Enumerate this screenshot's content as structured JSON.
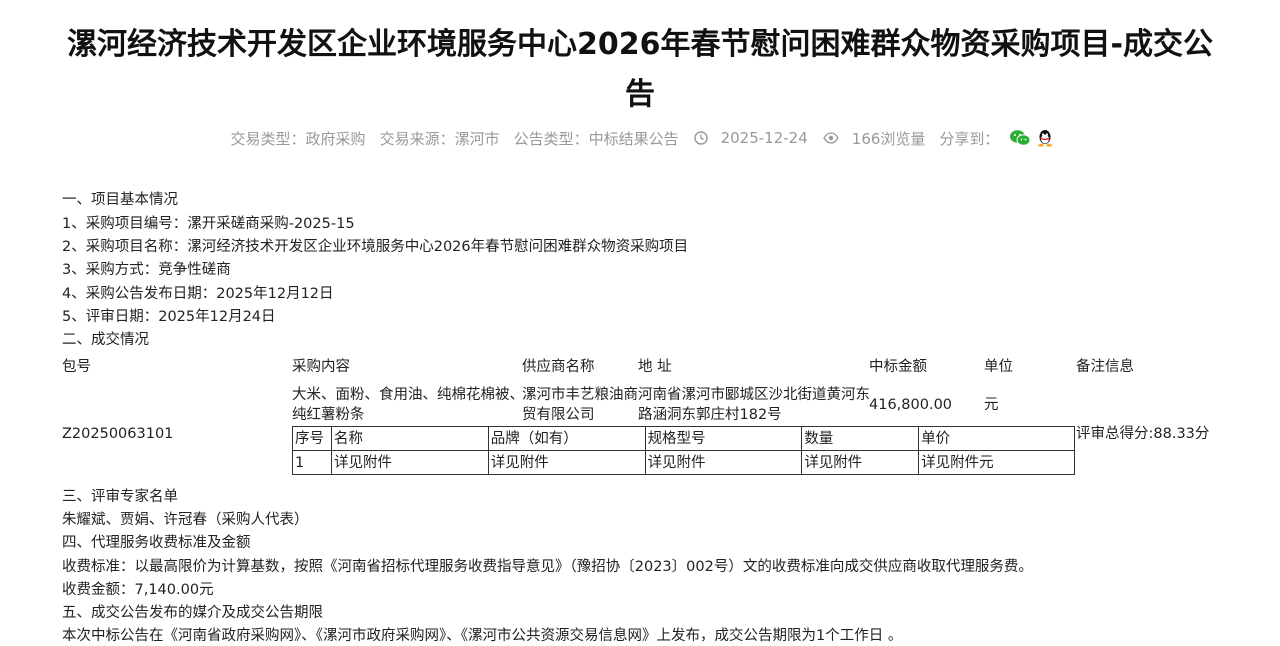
{
  "title": "漯河经济技术开发区企业环境服务中心2026年春节慰问困难群众物资采购项目-成交公告",
  "meta": {
    "trade_type": "交易类型：政府采购",
    "trade_source": "交易来源：漯河市",
    "notice_type": "公告类型：中标结果公告",
    "date": "2025-12-24",
    "views": "166浏览量",
    "share_label": "分享到："
  },
  "section1": {
    "heading": "一、项目基本情况",
    "items": [
      "1、采购项目编号：漯开采磋商采购-2025-15",
      "2、采购项目名称：漯河经济技术开发区企业环境服务中心2026年春节慰问困难群众物资采购项目",
      "3、采购方式：竞争性磋商",
      "4、采购公告发布日期：2025年12月12日",
      "5、评审日期：2025年12月24日"
    ]
  },
  "section2": {
    "heading": "二、成交情况",
    "headers": [
      "包号",
      "采购内容",
      "供应商名称",
      "地 址",
      "中标金额",
      "单位",
      "备注信息"
    ],
    "row": {
      "package": "Z20250063101",
      "content_line1": "大米、面粉、食用油、纯棉花棉被、",
      "content_line2": "纯红薯粉条",
      "supplier_line1": "漯河市丰艺粮油商",
      "supplier_line2": "贸有限公司",
      "address_line1": "河南省漯河市郾城区沙北街道黄河东",
      "address_line2": "路涵洞东郭庄村182号",
      "amount": "416,800.00",
      "unit": "元",
      "remark": "评审总得分:88.33分"
    },
    "sub_table": {
      "headers": [
        "序号",
        "名称",
        "品牌（如有）",
        "规格型号",
        "数量",
        "单价"
      ],
      "rows": [
        [
          "1",
          "详见附件",
          "详见附件",
          "详见附件",
          "详见附件",
          "详见附件元"
        ]
      ]
    }
  },
  "section3": {
    "heading": "三、评审专家名单",
    "text": "朱耀斌、贾娟、许冠春（采购人代表）"
  },
  "section4": {
    "heading": "四、代理服务收费标准及金额",
    "standard": "收费标准：以最高限价为计算基数，按照《河南省招标代理服务收费指导意见》（豫招协〔2023〕002号）文的收费标准向成交供应商收取代理服务费。",
    "amount": "收费金额：7,140.00元"
  },
  "section5": {
    "heading": "五、成交公告发布的媒介及成交公告期限",
    "text": "本次中标公告在《河南省政府采购网》、《漯河市政府采购网》、《漯河市公共资源交易信息网》上发布，成交公告期限为1个工作日 。"
  },
  "colors": {
    "wechat": "#2bad38",
    "meta_text": "#999999"
  },
  "icons": [
    "clock-icon",
    "eye-icon",
    "wechat-icon",
    "qq-icon"
  ]
}
